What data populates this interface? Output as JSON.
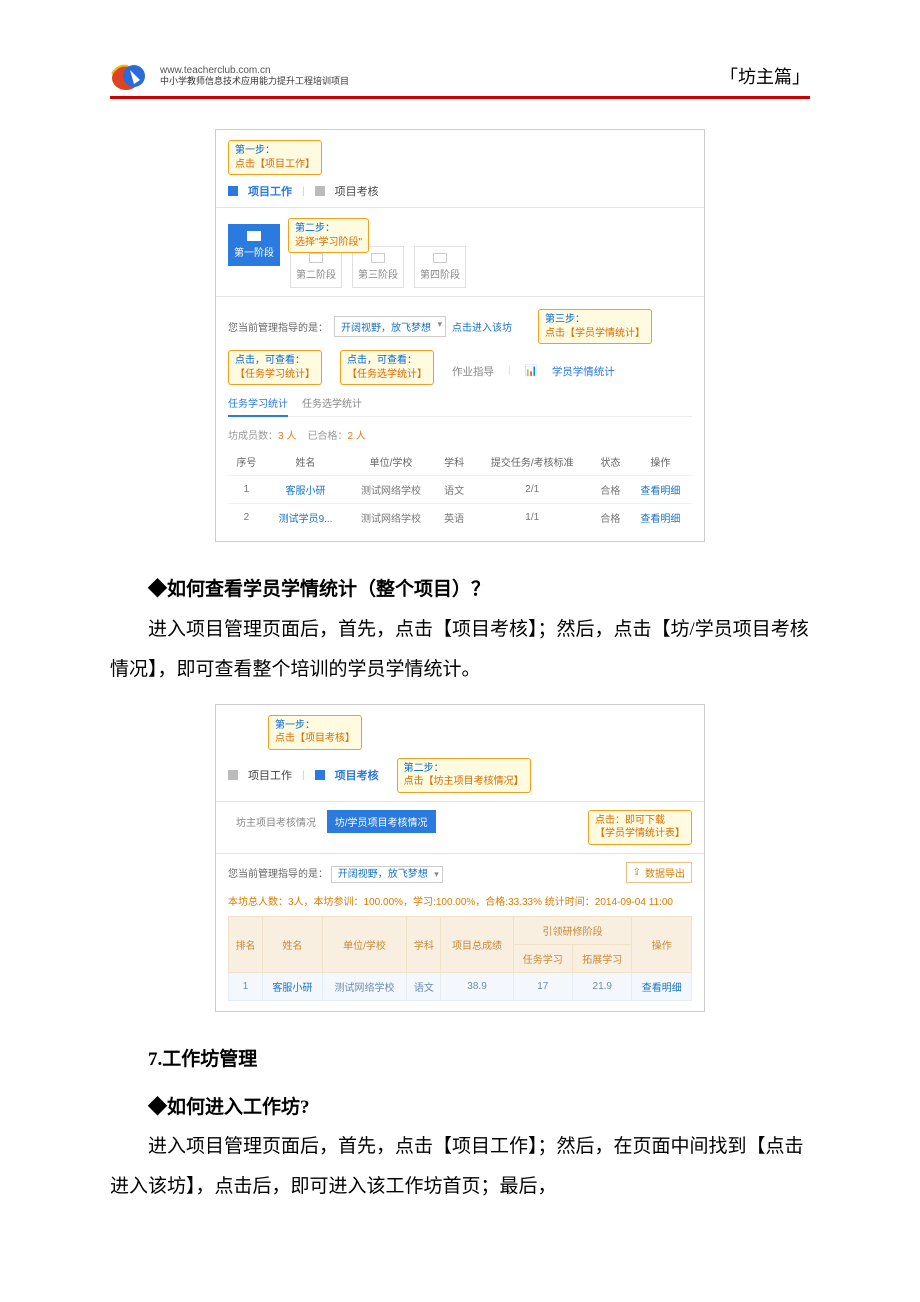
{
  "header": {
    "url": "www.teacherclub.com.cn",
    "subtitle": "中小学教师信息技术应用能力提升工程培训项目",
    "right": "「坊主篇」"
  },
  "shot1": {
    "callout1_line1": "第一步：",
    "callout1_line2": "点击【项目工作】",
    "tab_work": "项目工作",
    "tab_assess": "项目考核",
    "callout2_line1": "第二步：",
    "callout2_line2": "选择\"学习阶段\"",
    "stages": [
      "第一阶段",
      "第二阶段",
      "第三阶段",
      "第四阶段"
    ],
    "mgmt_label": "您当前管理指导的是：",
    "workshop_name": "开阔视野，放飞梦想",
    "enter_link": "点击进入该坊",
    "callout3_line1": "第三步：",
    "callout3_line2": "点击【学员学情统计】",
    "callout_l1_line1": "点击，可查看：",
    "callout_l1_line2": "【任务学习统计】",
    "callout_l2_line1": "点击，可查看：",
    "callout_l2_line2": "【任务选学统计】",
    "stat_tabs": [
      "",
      "",
      "作业指导",
      "学员学情统计"
    ],
    "subtab1": "任务学习统计",
    "subtab2": "任务选学统计",
    "counts_label1": "坊成员数：",
    "counts_n1": "3 人",
    "counts_label2": "已合格：",
    "counts_n2": "2 人",
    "cols": [
      "序号",
      "姓名",
      "单位/学校",
      "学科",
      "提交任务/考核标准",
      "状态",
      "操作"
    ],
    "rows": [
      [
        "1",
        "客服小研",
        "测试网络学校",
        "语文",
        "2/1",
        "合格",
        "查看明细"
      ],
      [
        "2",
        "测试学员9...",
        "测试网络学校",
        "英语",
        "1/1",
        "合格",
        "查看明细"
      ]
    ]
  },
  "para1_title": "◆如何查看学员学情统计（整个项目）？",
  "para1_body": "进入项目管理页面后，首先，点击【项目考核】；然后，点击【坊/学员项目考核情况】，即可查看整个培训的学员学情统计。",
  "shot2": {
    "callout1_line1": "第一步：",
    "callout1_line2": "点击【项目考核】",
    "tab_work": "项目工作",
    "tab_assess": "项目考核",
    "callout2_line1": "第二步：",
    "callout2_line2": "点击【坊主项目考核情况】",
    "subtab_gray": "坊主项目考核情况",
    "subtab_blue": "坊/学员项目考核情况",
    "callout_r_line1": "点击：即可下载",
    "callout_r_line2": "【学员学情统计表】",
    "mgmt_label": "您当前管理指导的是：",
    "workshop_name": "开阔视野，放飞梦想",
    "export": "数据导出",
    "summary": "本坊总人数：3人，本坊参训：100.00%，学习:100.00%，合格:33.33%    统计时间：2014-09-04 11:00",
    "cols_top": [
      "排名",
      "姓名",
      "单位/学校",
      "学科",
      "项目总成绩",
      "引领研修阶段",
      "操作"
    ],
    "cols_sub": [
      "任务学习",
      "拓展学习"
    ],
    "row": [
      "1",
      "客服小研",
      "测试网络学校",
      "语文",
      "38.9",
      "17",
      "21.9",
      "查看明细"
    ]
  },
  "sec7_title": "7.工作坊管理",
  "para2_title": "◆如何进入工作坊?",
  "para2_body": "进入项目管理页面后，首先，点击【项目工作】；然后，在页面中间找到【点击进入该坊】，点击后，即可进入该工作坊首页；最后，"
}
